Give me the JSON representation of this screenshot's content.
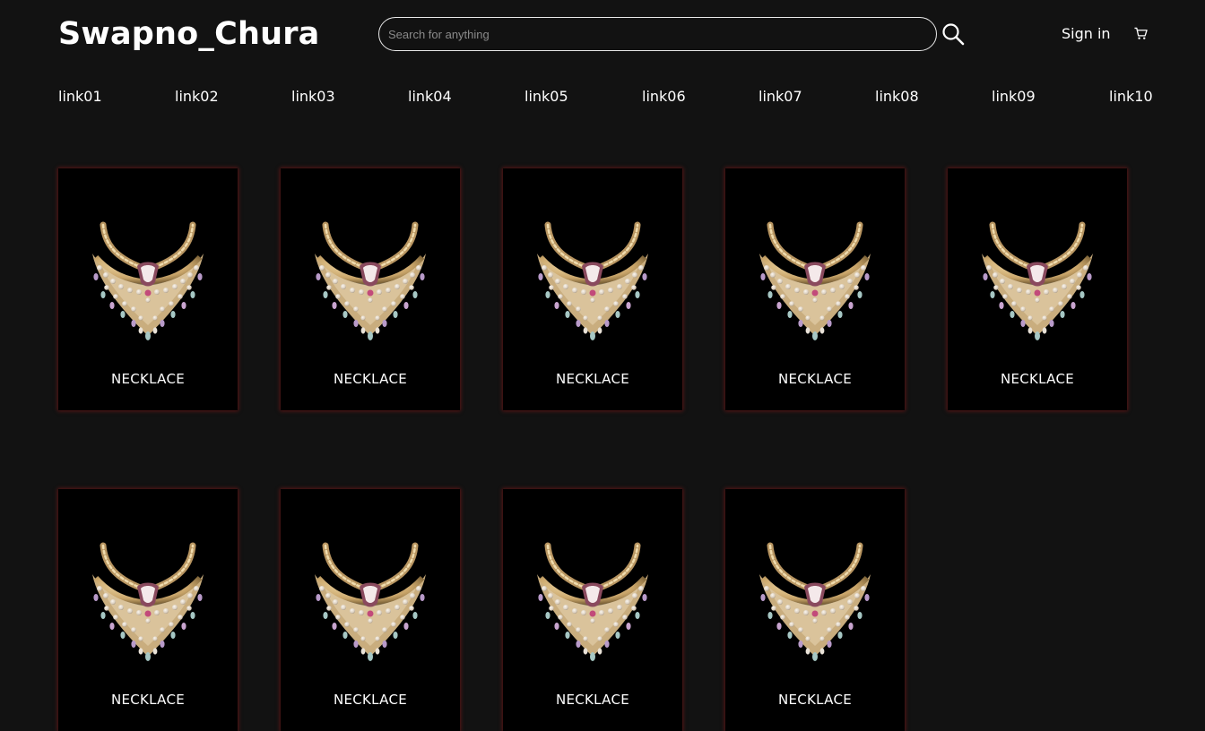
{
  "header": {
    "logo": "Swapno_Chura",
    "search_placeholder": "Search for anything",
    "signin_label": "Sign in"
  },
  "nav": {
    "links": [
      "link01",
      "link02",
      "link03",
      "link04",
      "link05",
      "link06",
      "link07",
      "link08",
      "link09",
      "link10"
    ]
  },
  "products": [
    {
      "label": "NECKLACE"
    },
    {
      "label": "NECKLACE"
    },
    {
      "label": "NECKLACE"
    },
    {
      "label": "NECKLACE"
    },
    {
      "label": "NECKLACE"
    },
    {
      "label": "NECKLACE"
    },
    {
      "label": "NECKLACE"
    },
    {
      "label": "NECKLACE"
    },
    {
      "label": "NECKLACE"
    }
  ],
  "icons": {
    "search": "search-icon",
    "cart": "cart-icon",
    "product_image": "necklace-image"
  },
  "colors": {
    "background": "#121212",
    "card_background": "#000000",
    "card_glow": "#961919",
    "text": "#ffffff"
  }
}
